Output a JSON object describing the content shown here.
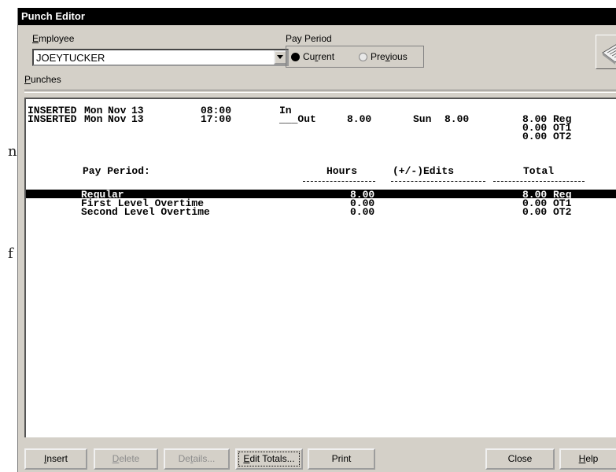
{
  "background_text": [
    "n",
    "f"
  ],
  "window": {
    "title": "Punch Editor"
  },
  "employee": {
    "label": "Employee",
    "value": "JOEYTUCKER"
  },
  "pay_period": {
    "label": "Pay Period",
    "options": [
      {
        "label": "Current",
        "selected": true
      },
      {
        "label": "Previous",
        "selected": false
      }
    ]
  },
  "punches_label": "Punches",
  "punches": [
    {
      "status": "INSERTED",
      "day": "Mon",
      "month": "Nov",
      "date": "13",
      "time": "08:00",
      "type": "In",
      "hours": "",
      "day2": "",
      "hours2": "",
      "totals": []
    },
    {
      "status": "INSERTED",
      "day": "Mon",
      "month": "Nov",
      "date": "13",
      "time": "17:00",
      "type": "___Out",
      "hours": "8.00",
      "day2": "Sun",
      "hours2": "8.00",
      "totals": [
        "8.00 Reg",
        "0.00 OT1",
        "0.00 OT2"
      ]
    }
  ],
  "summary": {
    "heading": "Pay Period:",
    "columns": [
      "Hours",
      "(+/-)Edits",
      "Total"
    ],
    "rows": [
      {
        "name": "Regular",
        "hours": "8.00",
        "edits": "",
        "total": "8.00 Reg",
        "selected": true
      },
      {
        "name": "First Level Overtime",
        "hours": "0.00",
        "edits": "",
        "total": "0.00 OT1",
        "selected": false
      },
      {
        "name": "Second Level Overtime",
        "hours": "0.00",
        "edits": "",
        "total": "0.00 OT2",
        "selected": false
      }
    ]
  },
  "buttons": {
    "insert": "Insert",
    "delete": "Delete",
    "details": "Details...",
    "edit_totals": "Edit Totals...",
    "print": "Print",
    "close": "Close",
    "help": "Help"
  },
  "icons": {
    "logo": "paper-notepad-icon",
    "combo": "chevron-down-icon"
  }
}
